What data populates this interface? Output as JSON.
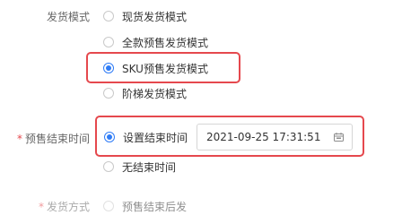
{
  "form": {
    "shipping_mode": {
      "label": "发货模式",
      "options": [
        {
          "label": "现货发货模式",
          "selected": false
        },
        {
          "label": "全款预售发货模式",
          "selected": false
        },
        {
          "label": "SKU预售发货模式",
          "selected": true
        },
        {
          "label": "阶梯发货模式",
          "selected": false
        }
      ]
    },
    "presale_end_time": {
      "required_mark": "*",
      "label": "预售结束时间",
      "options": [
        {
          "label": "设置结束时间",
          "selected": true
        },
        {
          "label": "无结束时间",
          "selected": false
        }
      ],
      "datetime_value": "2021-09-25 17:31:51",
      "datetime_icon": "calendar-icon"
    },
    "shipping_method": {
      "required_mark": "*",
      "label": "发货方式",
      "options": [
        {
          "label": "预售结束后发",
          "selected": false
        }
      ]
    }
  },
  "colors": {
    "accent": "#2f7cf6",
    "highlight": "#e5484d",
    "required": "#e5484d"
  }
}
